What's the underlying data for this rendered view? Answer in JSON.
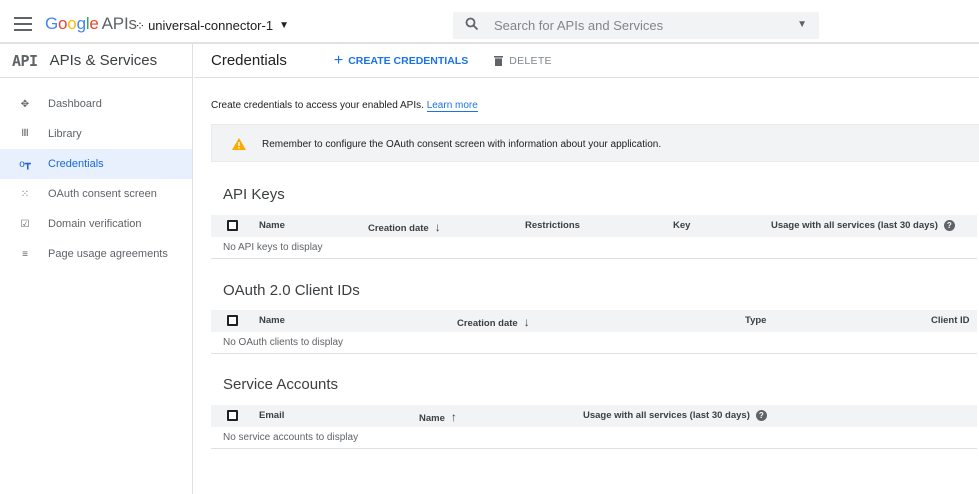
{
  "header": {
    "logo_google": [
      "G",
      "o",
      "o",
      "g",
      "l",
      "e"
    ],
    "logo_apis": "APIs",
    "project_name": "universal-connector-1",
    "search_placeholder": "Search for APIs and Services"
  },
  "sidebar": {
    "api_badge": "API",
    "title": "APIs & Services",
    "items": [
      {
        "label": "Dashboard",
        "icon": "dashboard-icon",
        "glyph": "✥",
        "active": false
      },
      {
        "label": "Library",
        "icon": "library-icon",
        "glyph": "𝍬",
        "active": false
      },
      {
        "label": "Credentials",
        "icon": "key-icon",
        "glyph": "o┳",
        "active": true
      },
      {
        "label": "OAuth consent screen",
        "icon": "consent-icon",
        "glyph": "⁙",
        "active": false
      },
      {
        "label": "Domain verification",
        "icon": "checkbox-icon",
        "glyph": "☑",
        "active": false
      },
      {
        "label": "Page usage agreements",
        "icon": "settings-list-icon",
        "glyph": "≡",
        "active": false
      }
    ]
  },
  "main": {
    "title": "Credentials",
    "create_label": "CREATE CREDENTIALS",
    "delete_label": "DELETE",
    "intro_text": "Create credentials to access your enabled APIs.",
    "learn_more": "Learn more",
    "alert_text": "Remember to configure the OAuth consent screen with information about your application."
  },
  "api_keys": {
    "title": "API Keys",
    "columns": [
      "Name",
      "Creation date",
      "Restrictions",
      "Key",
      "Usage with all services (last 30 days)"
    ],
    "empty": "No API keys to display"
  },
  "oauth": {
    "title": "OAuth 2.0 Client IDs",
    "columns": [
      "Name",
      "Creation date",
      "Type",
      "Client ID"
    ],
    "empty": "No OAuth clients to display"
  },
  "service_accounts": {
    "title": "Service Accounts",
    "columns": [
      "Email",
      "Name",
      "Usage with all services (last 30 days)"
    ],
    "empty": "No service accounts to display"
  },
  "colors": {
    "accent": "#1a73e8",
    "active_bg": "#e8f0fe",
    "warning": "#f9ab00"
  }
}
